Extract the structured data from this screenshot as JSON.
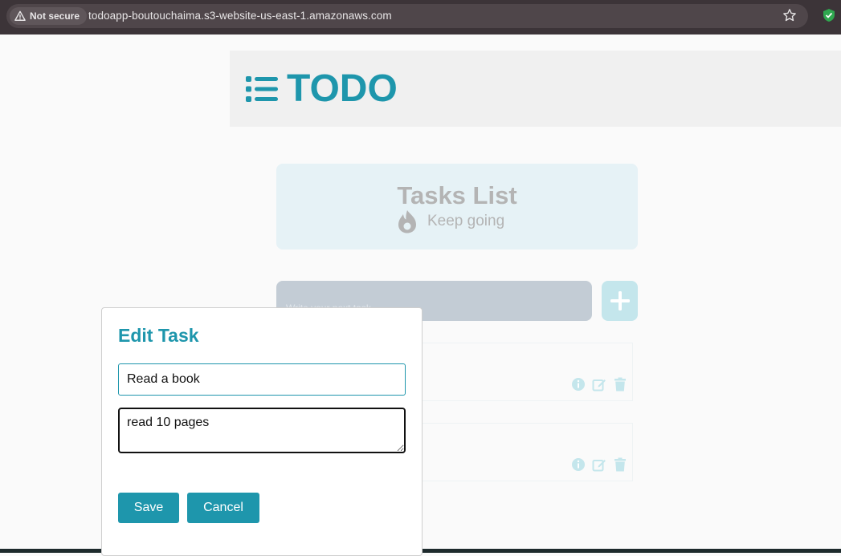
{
  "browser": {
    "security_label": "Not secure",
    "url": "todoapp-boutouchaima.s3-website-us-east-1.amazonaws.com"
  },
  "header": {
    "title": "TODO"
  },
  "tasks_card": {
    "title": "Tasks List",
    "subtitle": "Keep going"
  },
  "new_task": {
    "placeholder": "Write your next task"
  },
  "task_items": [
    {
      "actions": [
        "info-icon",
        "edit-icon",
        "trash-icon"
      ]
    },
    {
      "actions": [
        "info-icon",
        "edit-icon",
        "trash-icon"
      ]
    }
  ],
  "edit_modal": {
    "title": "Edit Task",
    "task_title_value": "Read a book",
    "task_description_value": "read 10 pages ",
    "save_label": "Save",
    "cancel_label": "Cancel"
  },
  "colors": {
    "accent": "#1e96ac",
    "faded_accent": "#c4e6ec",
    "card_bg": "#e6f2f6"
  }
}
